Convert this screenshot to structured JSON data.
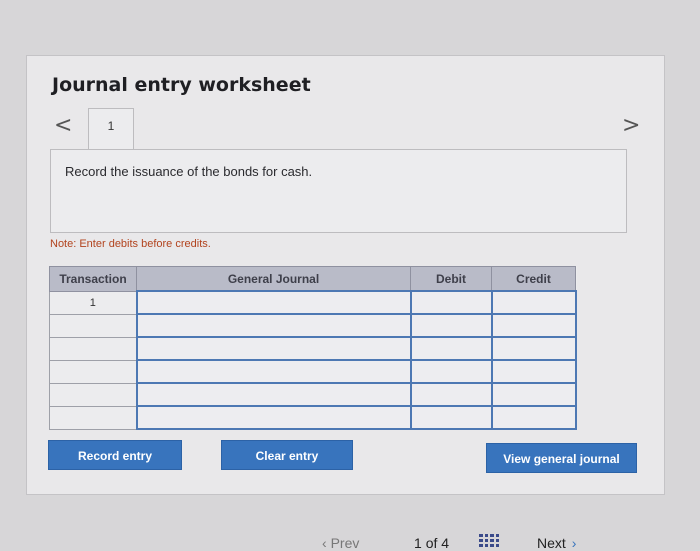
{
  "worksheet": {
    "title": "Journal entry worksheet",
    "tab_label": "1",
    "prev_icon": "<",
    "next_icon": ">",
    "description": "Record the issuance of the bonds for cash.",
    "note": "Note: Enter debits before credits."
  },
  "table": {
    "headers": [
      "Transaction",
      "General Journal",
      "Debit",
      "Credit"
    ],
    "rows": [
      {
        "transaction": "1",
        "account": "",
        "debit": "",
        "credit": ""
      },
      {
        "transaction": "",
        "account": "",
        "debit": "",
        "credit": ""
      },
      {
        "transaction": "",
        "account": "",
        "debit": "",
        "credit": ""
      },
      {
        "transaction": "",
        "account": "",
        "debit": "",
        "credit": ""
      },
      {
        "transaction": "",
        "account": "",
        "debit": "",
        "credit": ""
      },
      {
        "transaction": "",
        "account": "",
        "debit": "",
        "credit": ""
      }
    ]
  },
  "buttons": {
    "record": "Record entry",
    "clear": "Clear entry",
    "view": "View general journal"
  },
  "footer": {
    "prev_label": "Prev",
    "page_current": "1",
    "page_sep": "of",
    "page_total": "4",
    "next_label": "Next",
    "grid_icon": "grid-icon"
  },
  "colors": {
    "button_blue": "#3874bd",
    "header_gray": "#b9bbc8",
    "note_text": "#b2431e"
  }
}
